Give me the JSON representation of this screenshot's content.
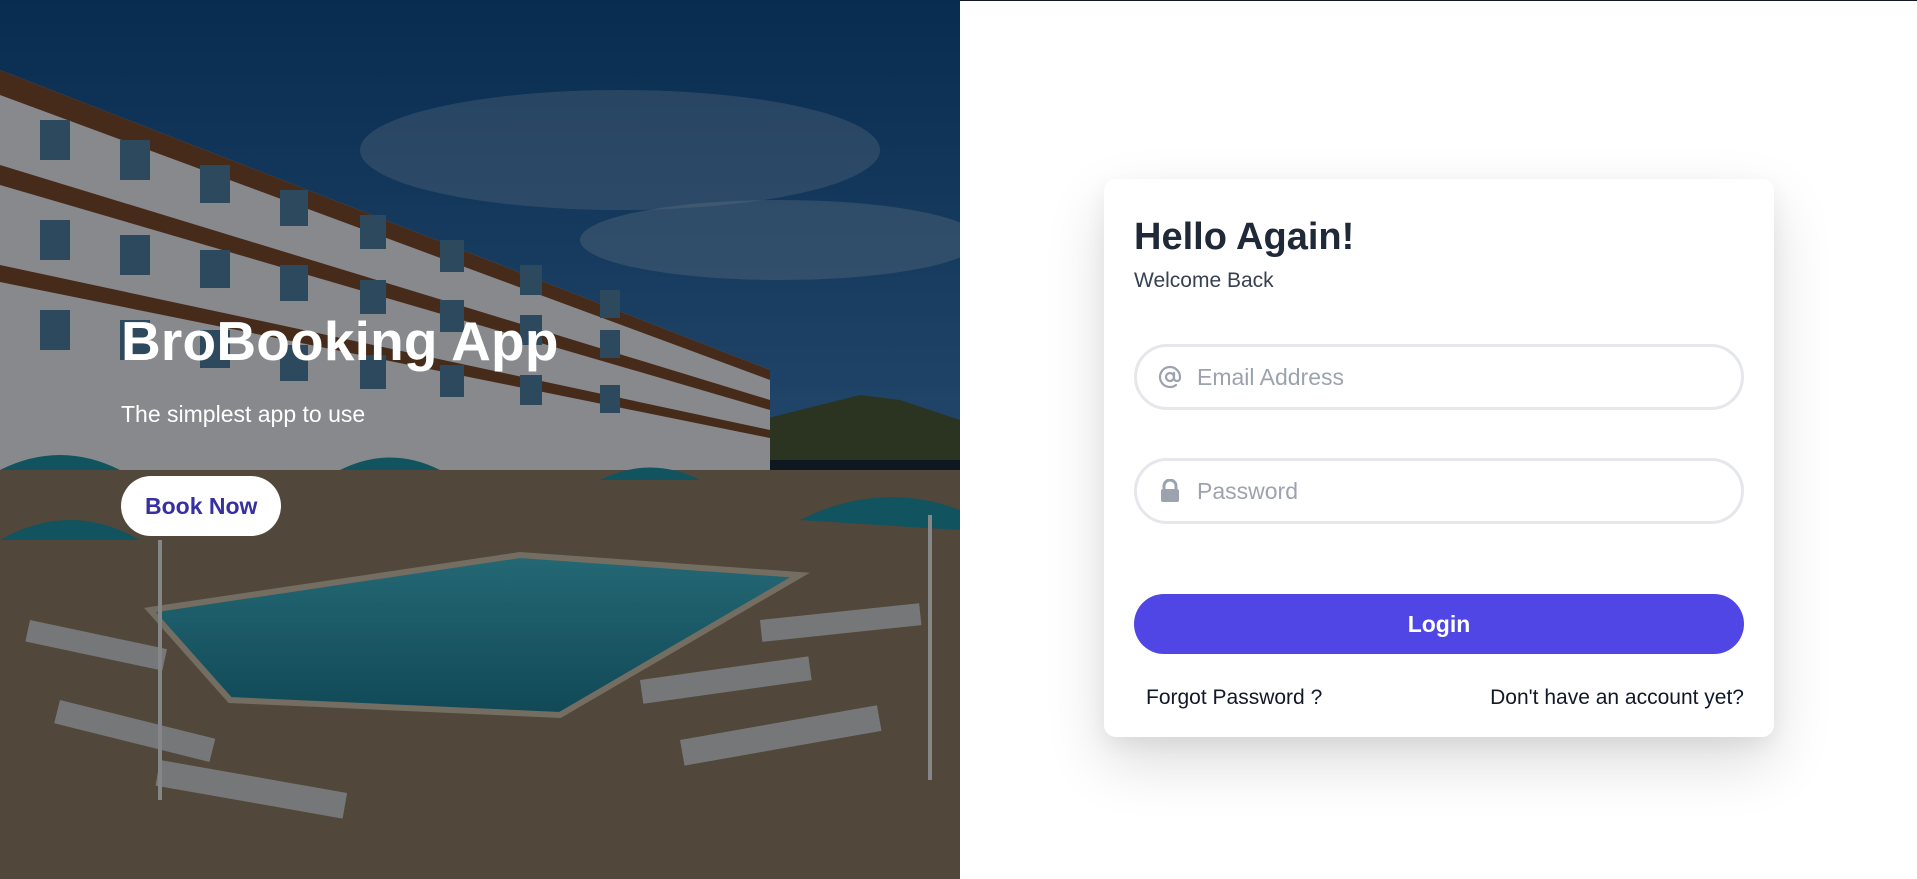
{
  "hero": {
    "title": "BroBooking App",
    "subtitle": "The simplest app to use",
    "cta_label": "Book Now",
    "image_description_icon": "hotel-pool-photo"
  },
  "login": {
    "title": "Hello Again!",
    "subtitle": "Welcome Back",
    "email": {
      "placeholder": "Email Address",
      "value": "",
      "icon": "at-sign-icon"
    },
    "password": {
      "placeholder": "Password",
      "value": "",
      "icon": "lock-icon"
    },
    "submit_label": "Login",
    "forgot_label": "Forgot Password ?",
    "signup_label": "Don't have an account yet?"
  },
  "colors": {
    "accent": "#4f46e5",
    "cta_text": "#3730a3",
    "heading": "#1f2937",
    "placeholder": "#9ca3af",
    "field_border": "#e5e7eb"
  }
}
